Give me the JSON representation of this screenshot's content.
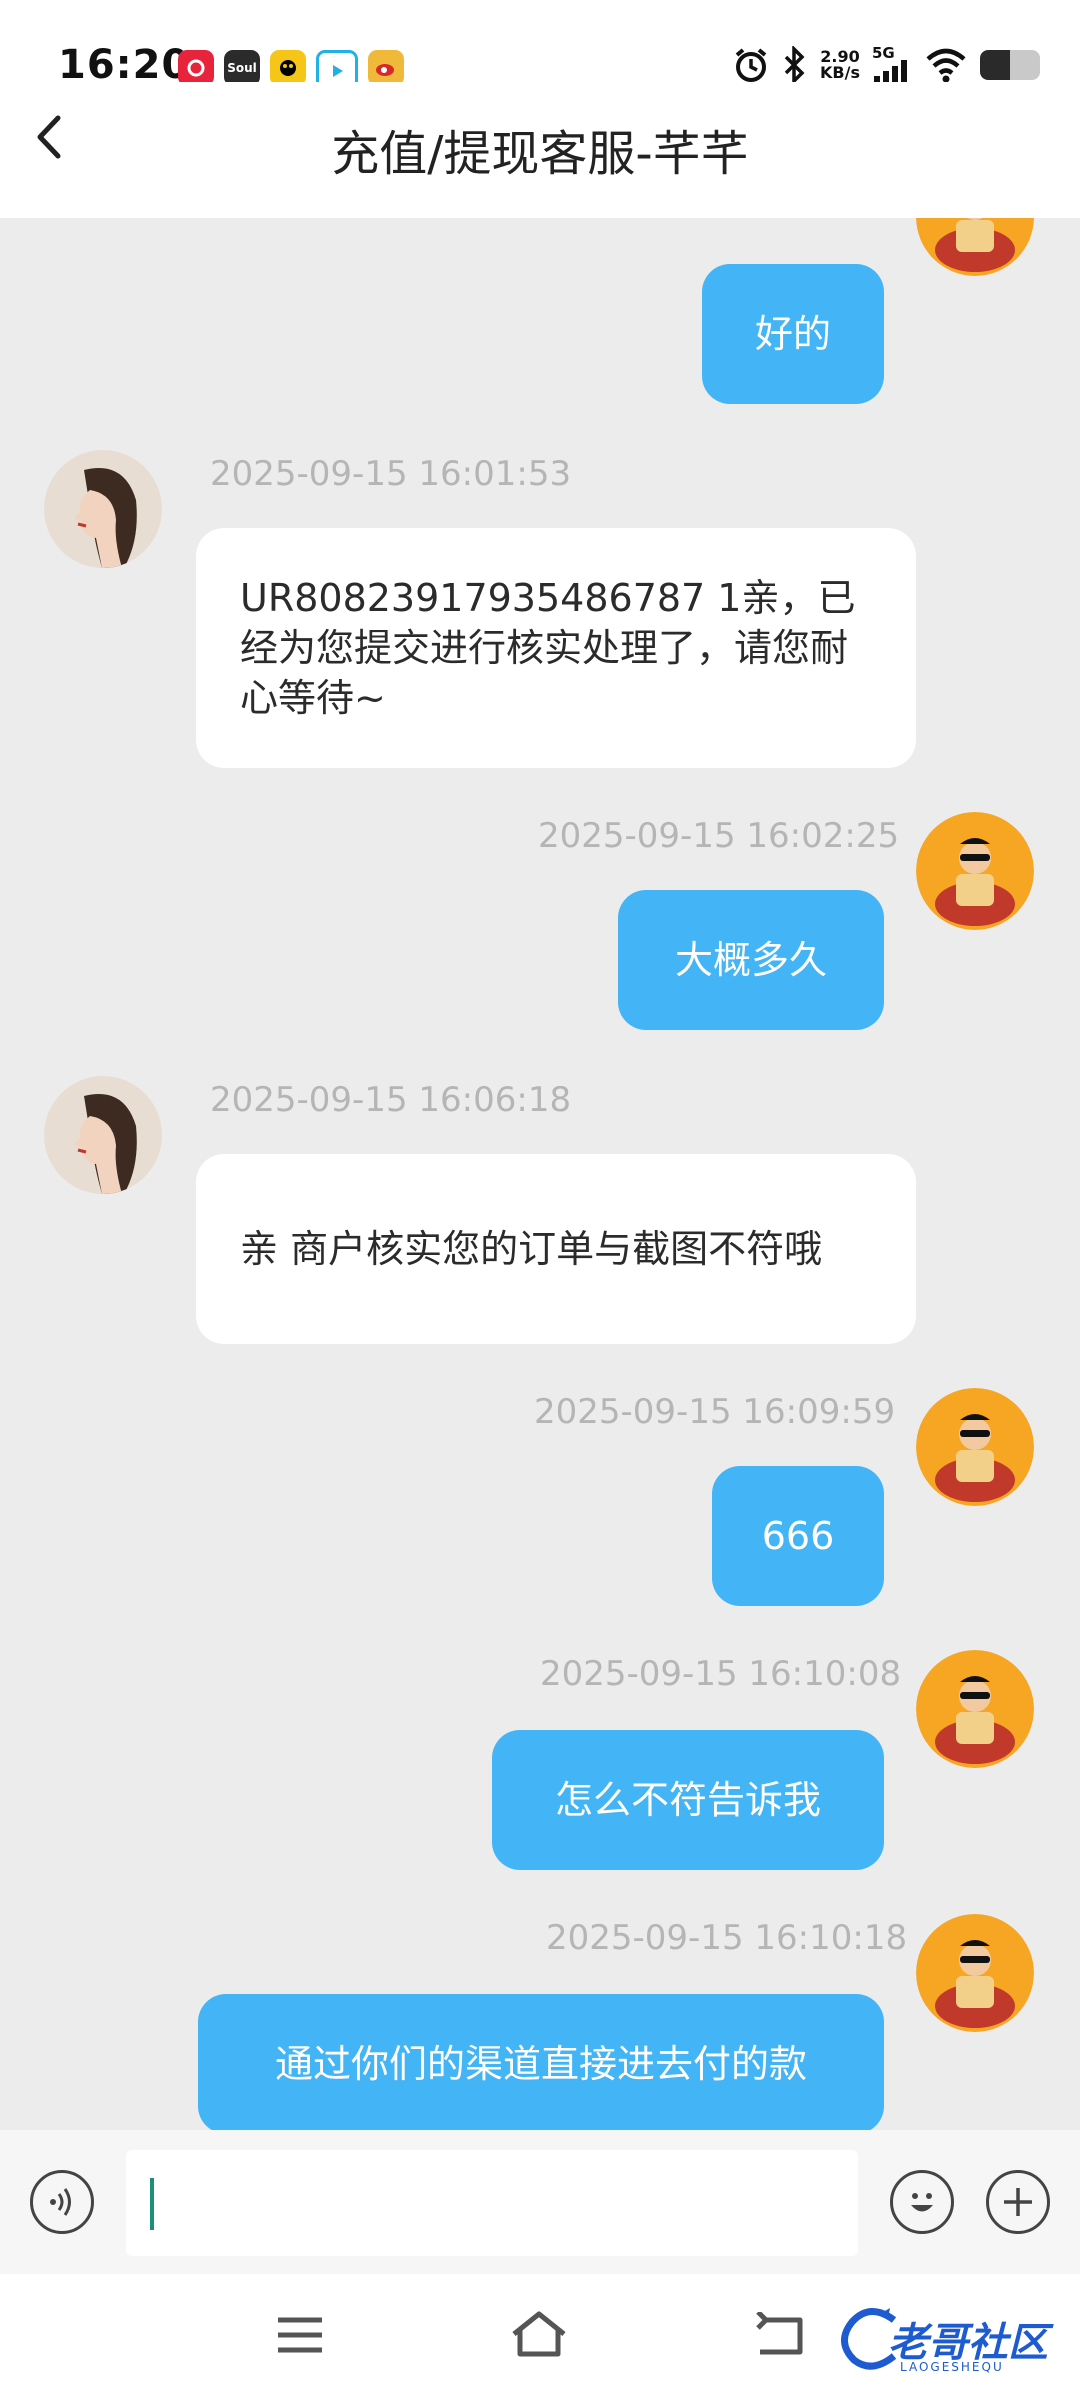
{
  "status_bar": {
    "time": "16:20",
    "net_speed_value": "2.90",
    "net_speed_unit": "KB/s",
    "network": "5G",
    "battery_level": 0.5,
    "app_icons": [
      "netease-music-icon",
      "soul-icon",
      "yellow-app-icon",
      "video-app-icon",
      "weibo-icon"
    ],
    "soul_label": "Soul"
  },
  "header": {
    "title": "充值/提现客服-芊芊"
  },
  "messages": [
    {
      "side": "out",
      "text": "好的"
    },
    {
      "side": "in",
      "time": "2025-09-15 16:01:53",
      "text": "UR80823917935486787 1亲，已经为您提交进行核实处理了，请您耐心等待~"
    },
    {
      "side": "out",
      "time": "2025-09-15 16:02:25",
      "text": "大概多久"
    },
    {
      "side": "in",
      "time": "2025-09-15 16:06:18",
      "text": "亲 商户核实您的订单与截图不符哦"
    },
    {
      "side": "out",
      "time": "2025-09-15 16:09:59",
      "text": "666"
    },
    {
      "side": "out",
      "time": "2025-09-15 16:10:08",
      "text": "怎么不符告诉我"
    },
    {
      "side": "out",
      "time": "2025-09-15 16:10:18",
      "text": "通过你们的渠道直接进去付的款"
    }
  ],
  "input": {
    "value": ""
  },
  "watermark": {
    "text": "老哥社区",
    "sub": "LAOGESHEQU"
  },
  "colors": {
    "bubble_out": "#43b4f5",
    "bubble_in": "#ffffff",
    "chat_bg": "#ececed",
    "caret": "#1a8f7a"
  }
}
